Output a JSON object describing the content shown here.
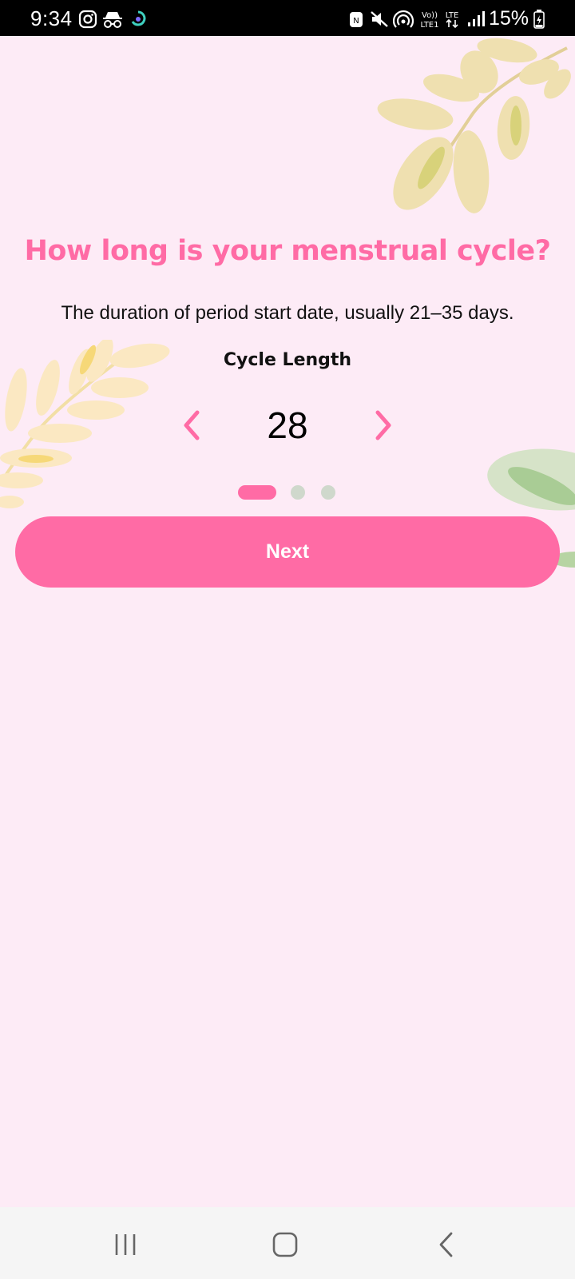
{
  "status_bar": {
    "time": "9:34",
    "battery": "15%",
    "icons": [
      "instagram-icon",
      "incognito-icon",
      "loading-app-icon",
      "nfc-icon",
      "mute-icon",
      "hotspot-icon",
      "volte-icon",
      "lte-icon",
      "signal-icon",
      "battery-icon"
    ]
  },
  "onboarding": {
    "title": "How long is your menstrual cycle?",
    "subtitle": "The duration of period start date, usually 21–35 days.",
    "picker_label": "Cycle Length",
    "value": "28",
    "page_indicator": {
      "total": 3,
      "current": 1
    },
    "next_label": "Next"
  },
  "nav_bar": {
    "buttons": [
      "recents-button",
      "home-button",
      "back-button"
    ]
  },
  "colors": {
    "accent": "#ff6ba5",
    "background": "#fdebf6",
    "dot_inactive": "#cfd8cc",
    "leaf_yellow": "#efe0b0",
    "leaf_green": "#cfdcc3"
  }
}
